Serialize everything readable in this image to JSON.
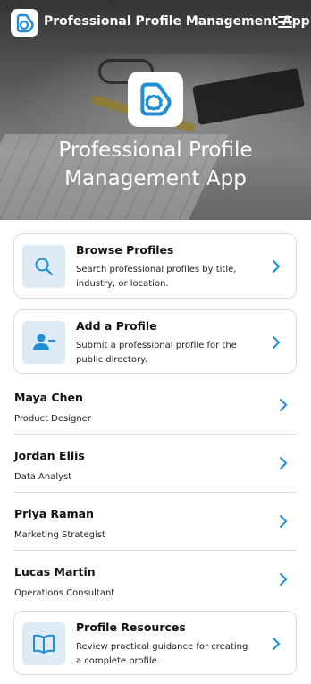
{
  "app": {
    "title": "Professional Profile Management App"
  },
  "hero": {
    "title_line1": "Professional Profile",
    "title_line2": "Management App"
  },
  "colors": {
    "accent": "#1e8fd6",
    "icon_bg": "#dcebf5"
  },
  "cards": {
    "browse": {
      "title": "Browse Profiles",
      "desc": "Search professional profiles by title, industry, or location.",
      "icon": "search-icon"
    },
    "add": {
      "title": "Add a Profile",
      "desc": "Submit a professional profile for the public directory.",
      "icon": "add-user-icon"
    },
    "resources": {
      "title": "Profile Resources",
      "desc": "Review practical guidance for creating a complete profile.",
      "icon": "book-icon"
    }
  },
  "profiles": [
    {
      "name": "Maya Chen",
      "role": "Product Designer"
    },
    {
      "name": "Jordan Ellis",
      "role": "Data Analyst"
    },
    {
      "name": "Priya Raman",
      "role": "Marketing Strategist"
    },
    {
      "name": "Lucas Martin",
      "role": "Operations Consultant"
    }
  ]
}
